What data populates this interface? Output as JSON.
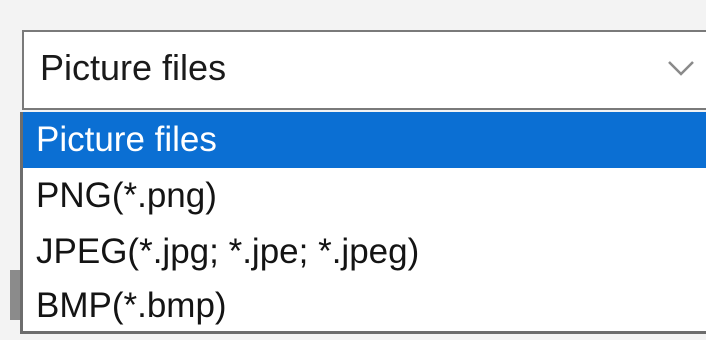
{
  "file_type_combo": {
    "selected_value": "Picture files",
    "arrow_icon": "chevron-down-icon",
    "options": [
      {
        "label": "Picture files",
        "selected": true
      },
      {
        "label": "PNG(*.png)",
        "selected": false
      },
      {
        "label": "JPEG(*.jpg; *.jpe; *.jpeg)",
        "selected": false
      },
      {
        "label": "BMP(*.bmp)",
        "selected": false
      }
    ]
  },
  "colors": {
    "selection_highlight": "#0b6fd3",
    "selection_text": "#ffffff",
    "background": "#f3f3f3",
    "border": "#7a7a7a"
  }
}
